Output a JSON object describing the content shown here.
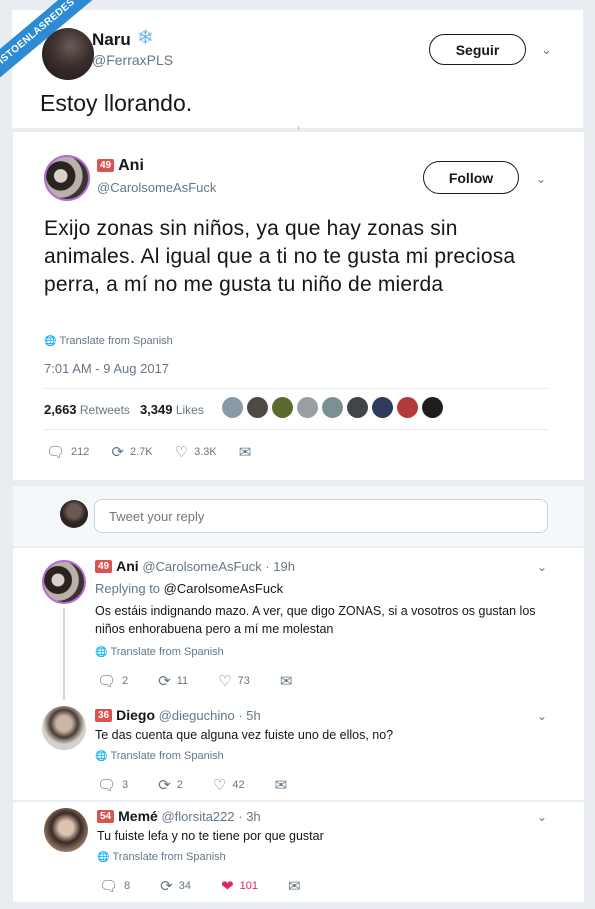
{
  "watermark": "VISTOENLASREDES",
  "outer": {
    "name": "Naru",
    "name_emoji": "❄",
    "handle": "@FerraxPLS",
    "follow_label": "Seguir",
    "text": "Estoy llorando."
  },
  "tweet": {
    "badge": "49",
    "name": "Ani",
    "handle": "@CarolsomeAsFuck",
    "follow_label": "Follow",
    "text": "Exijo zonas sin niños, ya que hay zonas sin animales. Al igual que a ti no te gusta mi preciosa perra, a mí no me gusta tu niño de mierda",
    "translate": "Translate from Spanish",
    "timestamp": "7:01 AM - 9 Aug 2017",
    "retweets_count": "2,663",
    "retweets_label": "Retweets",
    "likes_count": "3,349",
    "likes_label": "Likes",
    "replies": "212",
    "retweets_short": "2.7K",
    "likes_short": "3.3K"
  },
  "reply_box": {
    "placeholder": "Tweet your reply"
  },
  "replies": [
    {
      "badge": "49",
      "name": "Ani",
      "handle": "@CarolsomeAsFuck",
      "time": "· 19h",
      "replying_prefix": "Replying to",
      "replying_to": "@CarolsomeAsFuck",
      "text": "Os estáis indignando mazo. A ver, que digo ZONAS, si a vosotros os gustan los niños enhorabuena pero a mí me molestan",
      "translate": "Translate from Spanish",
      "replies": "2",
      "retweets": "11",
      "likes": "73"
    },
    {
      "badge": "36",
      "name": "Diego",
      "handle": "@dieguchino",
      "time": "· 5h",
      "text": "Te das cuenta que alguna vez fuiste uno de ellos, no?",
      "translate": "Translate from Spanish",
      "replies": "3",
      "retweets": "2",
      "likes": "42"
    },
    {
      "badge": "54",
      "name": "Memé",
      "handle": "@florsita222",
      "time": "· 3h",
      "text": "Tu fuiste lefa y no te tiene por que gustar",
      "translate": "Translate from Spanish",
      "replies": "8",
      "retweets": "34",
      "likes": "101"
    }
  ],
  "colors": {
    "accent_like": "#e0245e",
    "badge": "#d9534f",
    "ribbon": "#2c8bd3"
  }
}
